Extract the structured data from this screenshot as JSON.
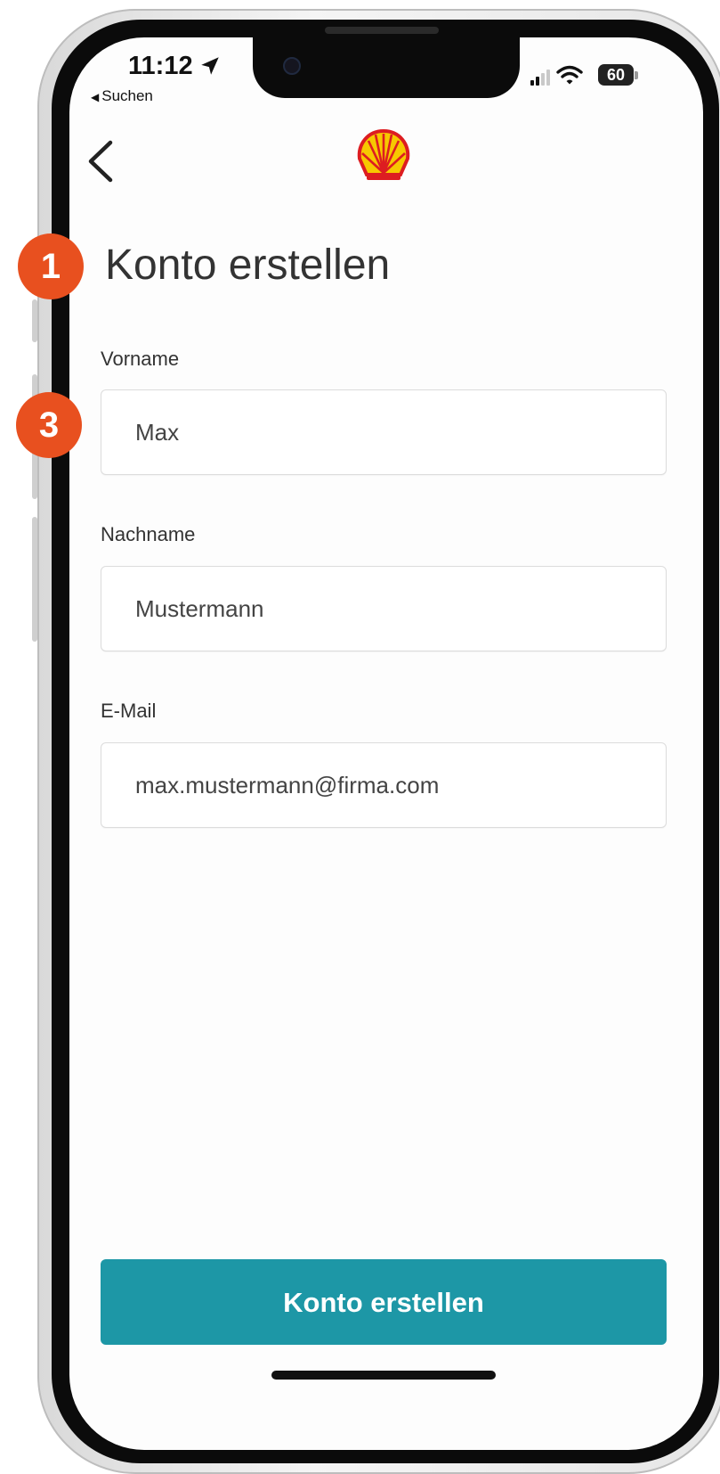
{
  "status_bar": {
    "time": "11:12",
    "back_app": "Suchen",
    "battery": "60"
  },
  "header": {
    "logo": "shell-logo"
  },
  "page": {
    "title": "Konto erstellen"
  },
  "annotations": {
    "badge_1": "1",
    "badge_3": "3",
    "color": "#e8501f"
  },
  "form": {
    "first_name": {
      "label": "Vorname",
      "value": "Max"
    },
    "last_name": {
      "label": "Nachname",
      "value": "Mustermann"
    },
    "email": {
      "label": "E-Mail",
      "value": "max.mustermann@firma.com"
    }
  },
  "submit": {
    "label": "Konto erstellen",
    "color": "#1d97a6"
  }
}
